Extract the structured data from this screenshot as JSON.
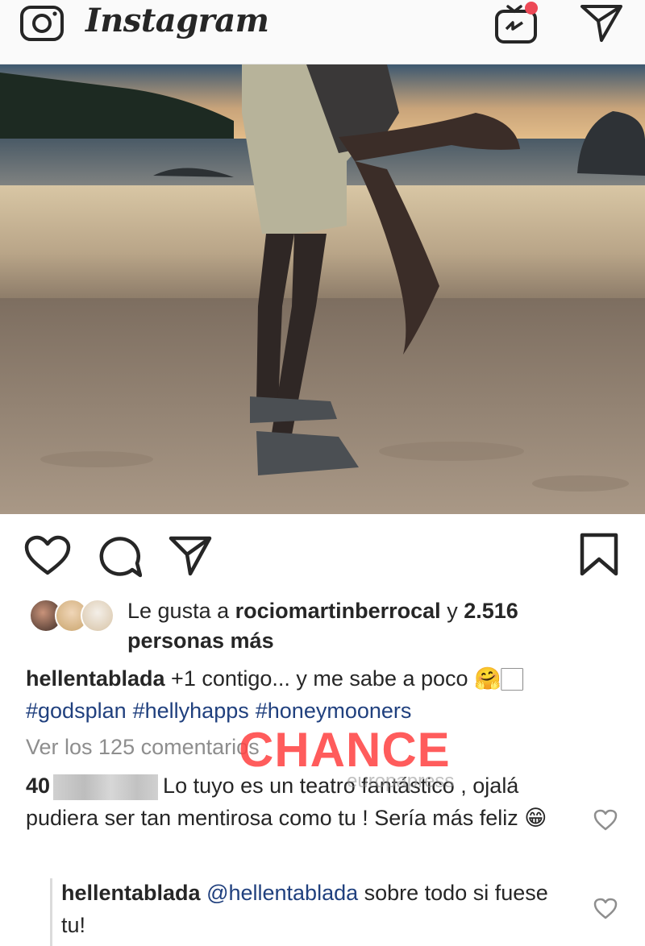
{
  "header": {
    "app_name": "Instagram",
    "icons": [
      "camera-icon",
      "igtv-icon",
      "direct-message-icon"
    ]
  },
  "post": {
    "actions": [
      "heart-icon",
      "comment-icon",
      "share-icon",
      "bookmark-icon"
    ],
    "likes": {
      "prefix": "Le gusta a ",
      "user": "rociomartinberrocal",
      "middle": " y ",
      "count": "2.516",
      "suffix": "personas más"
    },
    "caption": {
      "user": "hellentablada",
      "text": " +1 contigo... y me sabe a poco 🤗🏻",
      "hashtags": [
        "#godsplan",
        "#hellyhapps",
        "#honeymooners"
      ]
    },
    "view_all_comments": "Ver los 125 comentarios",
    "comments": [
      {
        "user_prefix": "40",
        "text": "Lo tuyo es un teatro fantástico , ojalá pudiera ser tan mentirosa como tu ! Sería más feliz 😁"
      }
    ],
    "reply": {
      "user": "hellentablada",
      "mention": "@hellentablada",
      "text": " sobre todo si fuese tu!"
    }
  },
  "watermark": {
    "main": "CHANCE",
    "sub": "europapress"
  },
  "colors": {
    "accent_red": "#ed4956",
    "hashtag_blue": "#20407e",
    "muted": "#8e8e8e",
    "watermark": "#ff4646"
  }
}
